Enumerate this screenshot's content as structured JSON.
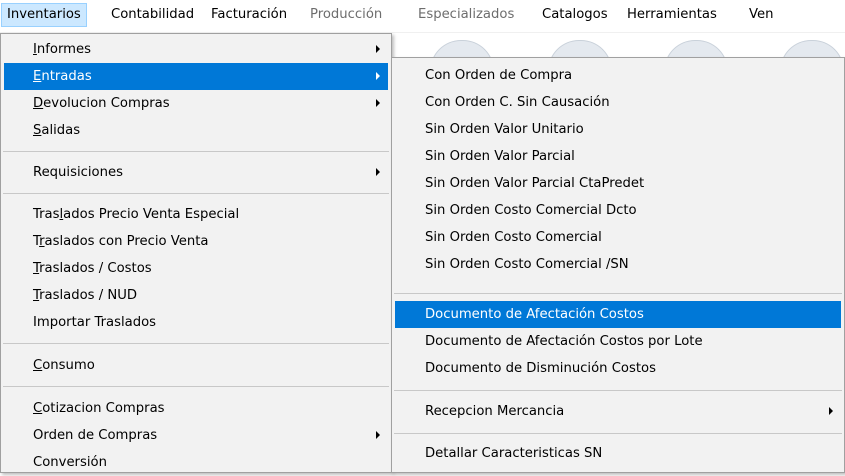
{
  "menubar": {
    "items": [
      {
        "label": "Inventarios",
        "state": "active"
      },
      {
        "label": "Contabilidad",
        "state": "normal"
      },
      {
        "label": "Facturación",
        "state": "normal"
      },
      {
        "label": "Producción",
        "state": "disabled"
      },
      {
        "label": "Especializados",
        "state": "disabled"
      },
      {
        "label": "Catalogos",
        "state": "normal"
      },
      {
        "label": "Herramientas",
        "state": "normal"
      },
      {
        "label": "Ven",
        "state": "normal"
      }
    ]
  },
  "inventarios_menu": {
    "items": [
      {
        "pre": "",
        "key": "I",
        "post": "nformes",
        "submenu": true
      },
      {
        "pre": "",
        "key": "E",
        "post": "ntradas",
        "submenu": true,
        "highlight": true
      },
      {
        "pre": "",
        "key": "D",
        "post": "evolucion Compras",
        "submenu": true
      },
      {
        "pre": "",
        "key": "S",
        "post": "alidas",
        "submenu": false
      },
      {
        "pre": "Requisiciones",
        "key": "",
        "post": "",
        "submenu": true
      },
      {
        "pre": "Tras",
        "key": "l",
        "post": "ados  Precio Venta Especial",
        "submenu": false
      },
      {
        "pre": "T",
        "key": "r",
        "post": "aslados con Precio Venta",
        "submenu": false
      },
      {
        "pre": "",
        "key": "T",
        "post": "raslados  / Costos",
        "submenu": false
      },
      {
        "pre": "",
        "key": "T",
        "post": "raslados / NUD",
        "submenu": false
      },
      {
        "pre": "Importar Traslados",
        "key": "",
        "post": "",
        "submenu": false
      },
      {
        "pre": "",
        "key": "C",
        "post": "onsumo",
        "submenu": false
      },
      {
        "pre": "",
        "key": "C",
        "post": "otizacion Compras",
        "submenu": false
      },
      {
        "pre": "Orden de Compras",
        "key": "",
        "post": "",
        "submenu": true
      },
      {
        "pre": "Conversión",
        "key": "",
        "post": "",
        "submenu": false
      }
    ]
  },
  "entradas_submenu": {
    "items": [
      {
        "label": "Con Orden de Compra",
        "submenu": false
      },
      {
        "label": "Con Orden C. Sin Causación",
        "submenu": false
      },
      {
        "label": "Sin Orden Valor Unitario",
        "submenu": false
      },
      {
        "label": "Sin Orden Valor Parcial",
        "submenu": false
      },
      {
        "label": "Sin Orden Valor Parcial CtaPredet",
        "submenu": false
      },
      {
        "label": "Sin Orden Costo Comercial Dcto",
        "submenu": false
      },
      {
        "label": "Sin Orden Costo Comercial",
        "submenu": false
      },
      {
        "label": "Sin Orden Costo Comercial /SN",
        "submenu": false
      },
      {
        "label": "Documento de Afectación Costos",
        "submenu": false,
        "highlight": true
      },
      {
        "label": "Documento de Afectación Costos por Lote",
        "submenu": false
      },
      {
        "label": "Documento de Disminución Costos",
        "submenu": false
      },
      {
        "label": "Recepcion Mercancia",
        "submenu": true
      },
      {
        "label": "Detallar Caracteristicas SN",
        "submenu": false
      }
    ]
  },
  "colors": {
    "highlight": "#0078d7",
    "menubar_active": "#cce8ff",
    "menu_background": "#f2f2f2",
    "disabled_text": "#6d6d6d"
  }
}
